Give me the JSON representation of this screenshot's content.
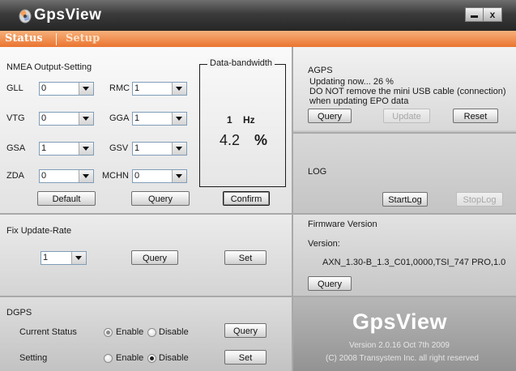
{
  "title_bar": {
    "app_title": "GpsView",
    "minimize_icon": "minimize-icon",
    "close_label": "x"
  },
  "tabs": [
    {
      "label": "Status"
    },
    {
      "label": "Setup"
    }
  ],
  "nmea": {
    "section_title": "NMEA Output-Setting",
    "fields": [
      {
        "label": "GLL",
        "value": "0"
      },
      {
        "label": "RMC",
        "value": "1"
      },
      {
        "label": "VTG",
        "value": "0"
      },
      {
        "label": "GGA",
        "value": "1"
      },
      {
        "label": "GSA",
        "value": "1"
      },
      {
        "label": "GSV",
        "value": "1"
      },
      {
        "label": "ZDA",
        "value": "0"
      },
      {
        "label": "MCHN",
        "value": "0"
      }
    ],
    "default_button": "Default",
    "query_button": "Query",
    "confirm_button": "Confirm"
  },
  "bandwidth": {
    "title": "Data-bandwidth",
    "rate": "1",
    "rate_unit": "Hz",
    "percent": "4.2",
    "percent_unit": "%"
  },
  "fix_update": {
    "section_title": "Fix Update-Rate",
    "value": "1",
    "query_button": "Query",
    "set_button": "Set"
  },
  "dgps": {
    "section_title": "DGPS",
    "current_status_label": "Current Status",
    "setting_label": "Setting",
    "enable_label": "Enable",
    "disable_label": "Disable",
    "current_selected": "Enable",
    "setting_selected": "Disable",
    "query_button": "Query",
    "set_button": "Set"
  },
  "agps": {
    "section_title": "AGPS",
    "status_line": "Updating now... 26 %",
    "warning_line1": "DO NOT remove the mini USB cable (connection)",
    "warning_line2": "when updating EPO data",
    "query_button": "Query",
    "update_button": "Update",
    "reset_button": "Reset"
  },
  "log": {
    "section_title": "LOG",
    "start_button": "StartLog",
    "stop_button": "StopLog"
  },
  "firmware": {
    "section_title": "Firmware Version",
    "version_label": "Version:",
    "version_value": "AXN_1.30-B_1.3_C01,0000,TSI_747 PRO,1.0",
    "query_button": "Query"
  },
  "about": {
    "logo_text": "GpsView",
    "version_line": "Version 2.0.16 Oct  7th 2009",
    "copyright_line": "(C) 2008 Transystem Inc.  all right reserved"
  }
}
